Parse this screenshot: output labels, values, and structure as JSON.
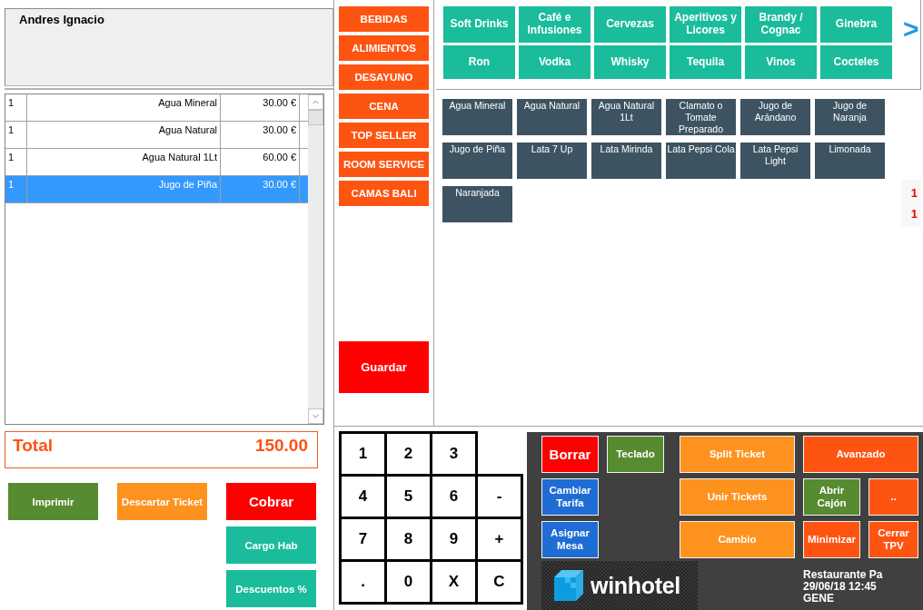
{
  "customer": {
    "name": "Andres Ignacio"
  },
  "order_lines": [
    {
      "quantity": "1",
      "item": "Agua Mineral",
      "price": "30.00 €",
      "selected": false
    },
    {
      "quantity": "1",
      "item": "Agua Natural",
      "price": "30.00 €",
      "selected": false
    },
    {
      "quantity": "1",
      "item": "Agua Natural 1Lt",
      "price": "60.00 €",
      "selected": false
    },
    {
      "quantity": "1",
      "item": "Jugo de Piña",
      "price": "30.00 €",
      "selected": true
    }
  ],
  "total": {
    "label": "Total",
    "amount": "150.00"
  },
  "ticket_columns": [
    {
      "buttons": [
        {
          "label": "Imprimir",
          "color": "#568b2f",
          "kind": "normal"
        }
      ]
    },
    {
      "buttons": [
        {
          "label": "Descartar Ticket",
          "color": "#fe921e",
          "kind": "normal"
        }
      ]
    },
    {
      "buttons": [
        {
          "label": "Cobrar",
          "color": "#ff0000",
          "kind": "primary"
        },
        {
          "label": "Cargo Hab",
          "color": "#1abc9c",
          "kind": "normal"
        },
        {
          "label": "Descuentos %",
          "color": "#1abc9c",
          "kind": "normal"
        }
      ]
    }
  ],
  "categories": [
    "BEBIDAS",
    "ALIMIENTOS",
    "DESAYUNO",
    "CENA",
    "TOP SELLER",
    "ROOM SERVICE",
    "CAMAS BALI"
  ],
  "save_button": "Guardar",
  "subcategories": [
    "Soft Drinks",
    "Café e Infusiones",
    "Cervezas",
    "Aperitivos y Licores",
    "Brandy / Cognac",
    "Ginebra",
    "Ron",
    "Vodka",
    "Whisky",
    "Tequila",
    "Vinos",
    "Cocteles"
  ],
  "next_page": ">",
  "products": [
    "Agua Mineral",
    "Agua Natural",
    "Agua Natural 1Lt",
    "Clamato o Tomate Preparado",
    "Jugo de Arándano",
    "Jugo de Naranja",
    "Jugo de Piña",
    "Lata 7 Up",
    "Lata Mirinda",
    "Lata Pepsi Cola",
    "Lata Pepsi Light",
    "Limonada",
    "Naranjada"
  ],
  "side_markers": [
    "1",
    "1"
  ],
  "numpad": {
    "rows": [
      [
        "1",
        "2",
        "3"
      ],
      [
        "4",
        "5",
        "6",
        "-"
      ],
      [
        "7",
        "8",
        "9",
        "+"
      ],
      [
        ".",
        "0",
        "X",
        "C"
      ]
    ]
  },
  "function_columns": [
    {
      "kind": "narrow",
      "buttons": [
        {
          "label": "Borrar",
          "color": "#ff0000",
          "kind": "primary"
        },
        {
          "label": "Cambiar Tarifa",
          "color": "#1f6dd4",
          "kind": "normal"
        },
        {
          "label": "Asignar Mesa",
          "color": "#1f6dd4",
          "kind": "normal"
        }
      ]
    },
    {
      "kind": "narrow",
      "buttons": [
        {
          "label": "Teclado",
          "color": "#568b2f",
          "kind": "normal"
        }
      ]
    },
    {
      "kind": "wide",
      "buttons": [
        {
          "label": "Split Ticket",
          "color": "#fe921e",
          "kind": "normal"
        },
        {
          "label": "Unir Tickets",
          "color": "#fe921e",
          "kind": "normal"
        },
        {
          "label": "Cambio",
          "color": "#fe921e",
          "kind": "normal"
        }
      ]
    },
    {
      "kind": "tiles",
      "buttons": [
        {
          "label": "Avanzado",
          "color": "#fe5412",
          "kind": "normal"
        },
        {
          "label": "Abrir Cajón",
          "color": "#568b2f",
          "kind": "normal"
        },
        {
          "label": "..",
          "color": "#fe5412",
          "kind": "normal"
        },
        {
          "label": "Minimizar",
          "color": "#fe5412",
          "kind": "normal"
        },
        {
          "label": "Cerrar TPV",
          "color": "#fe5412",
          "kind": "normal"
        }
      ]
    }
  ],
  "logo": {
    "text": "winhotel"
  },
  "status_lines": [
    "Restaurante Pa",
    "29/06/18 12:45",
    "GENE"
  ]
}
